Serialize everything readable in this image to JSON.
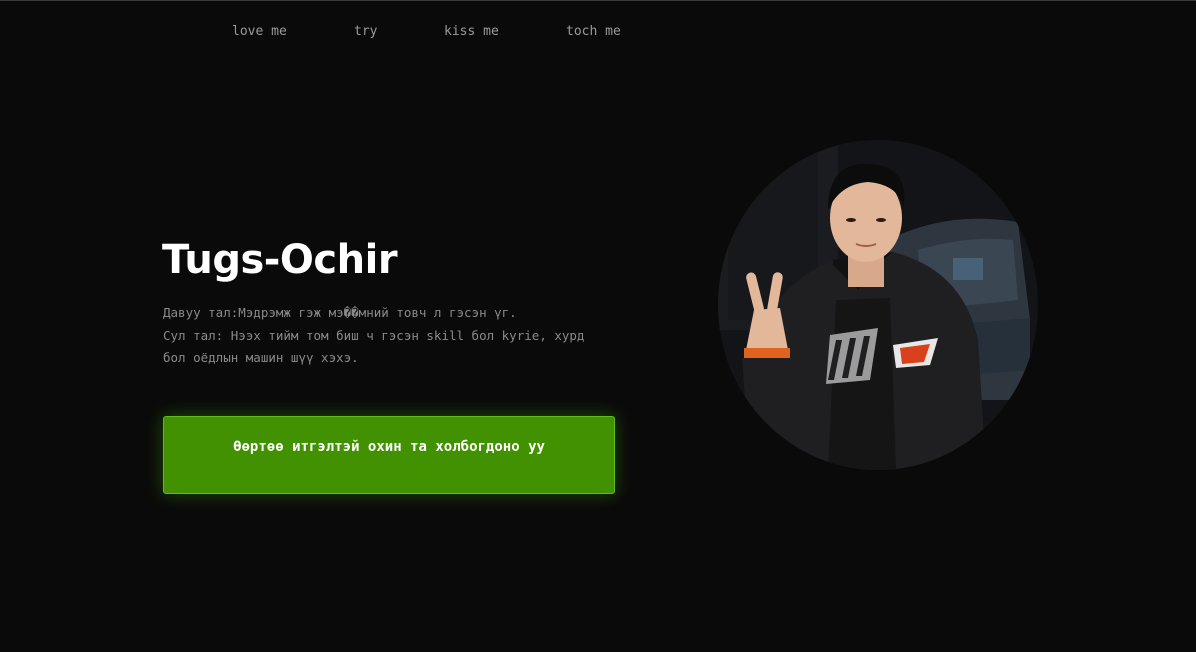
{
  "nav": {
    "items": [
      {
        "label": "love me"
      },
      {
        "label": "try"
      },
      {
        "label": "kiss me"
      },
      {
        "label": "toch me"
      }
    ]
  },
  "hero": {
    "name": "Tugs-Ochir",
    "bio_lines": [
      "Давуу тал:Мэдрэмж гэж мэ��мний товч л гэсэн үг.",
      "Сул тал: Нээх тийм том биш ч гэсэн skill бол kyrie, хурд",
      "бол оёдлын машин шүү хэхэ."
    ],
    "cta_label": "Өөртөө итгэлтэй охин та холбогдоно уу"
  },
  "photo": {
    "subject": "portrait-photo"
  },
  "colors": {
    "background": "#0a0a0a",
    "accent": "#419100",
    "text": "#ffffff",
    "muted": "#8a8a8a"
  }
}
